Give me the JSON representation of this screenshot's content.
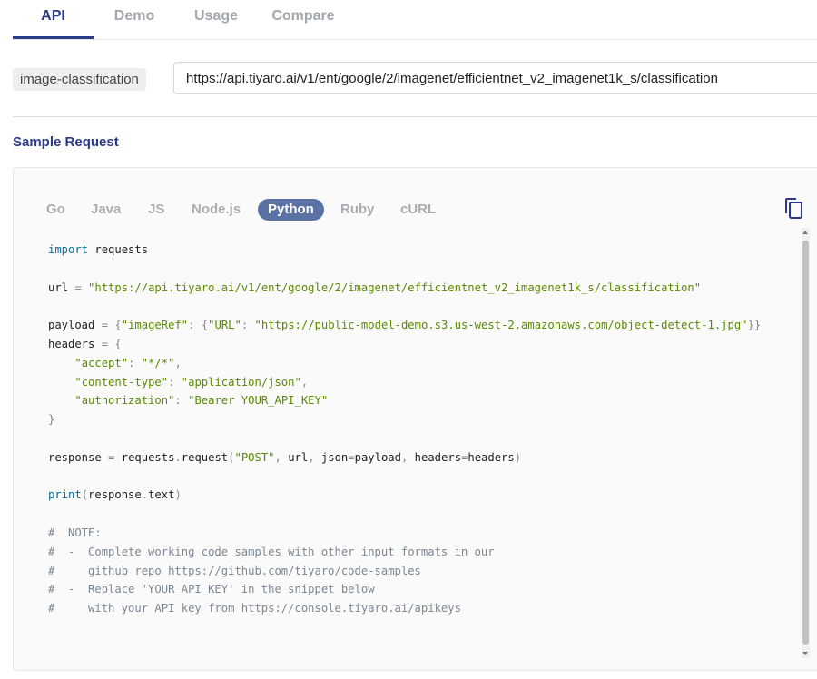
{
  "tabs": [
    {
      "label": "API",
      "active": true
    },
    {
      "label": "Demo",
      "active": false
    },
    {
      "label": "Usage",
      "active": false
    },
    {
      "label": "Compare",
      "active": false
    }
  ],
  "endpoint": {
    "tag": "image-classification",
    "url": "https://api.tiyaro.ai/v1/ent/google/2/imagenet/efficientnet_v2_imagenet1k_s/classification"
  },
  "sample_request": {
    "title": "Sample Request",
    "languages": [
      "Go",
      "Java",
      "JS",
      "Node.js",
      "Python",
      "Ruby",
      "cURL"
    ],
    "selected_language": "Python",
    "copy_icon": "copy-icon",
    "code": {
      "import_kw": "import",
      "import_mod": "requests",
      "url_var": "url",
      "url_value": "\"https://api.tiyaro.ai/v1/ent/google/2/imagenet/efficientnet_v2_imagenet1k_s/classification\"",
      "payload_var": "payload",
      "payload_key1": "\"imageRef\"",
      "payload_key2": "\"URL\"",
      "payload_value": "\"https://public-model-demo.s3.us-west-2.amazonaws.com/object-detect-1.jpg\"",
      "headers_var": "headers",
      "h1_key": "\"accept\"",
      "h1_val": "\"*/*\"",
      "h2_key": "\"content-type\"",
      "h2_val": "\"application/json\"",
      "h3_key": "\"authorization\"",
      "h3_val": "\"Bearer YOUR_API_KEY\"",
      "response_var": "response",
      "request_call": "requests",
      "request_method": "request",
      "method_str": "\"POST\"",
      "print_kw": "print",
      "print_arg": "response",
      "print_attr": "text",
      "comments": [
        "#  NOTE:",
        "#  -  Complete working code samples with other input formats in our",
        "#     github repo https://github.com/tiyaro/code-samples",
        "#  -  Replace 'YOUR_API_KEY' in the snippet below",
        "#     with your API key from https://console.tiyaro.ai/apikeys"
      ]
    }
  },
  "colors": {
    "accent": "#2b3a86",
    "selected_language_bg": "#5b72a4"
  }
}
